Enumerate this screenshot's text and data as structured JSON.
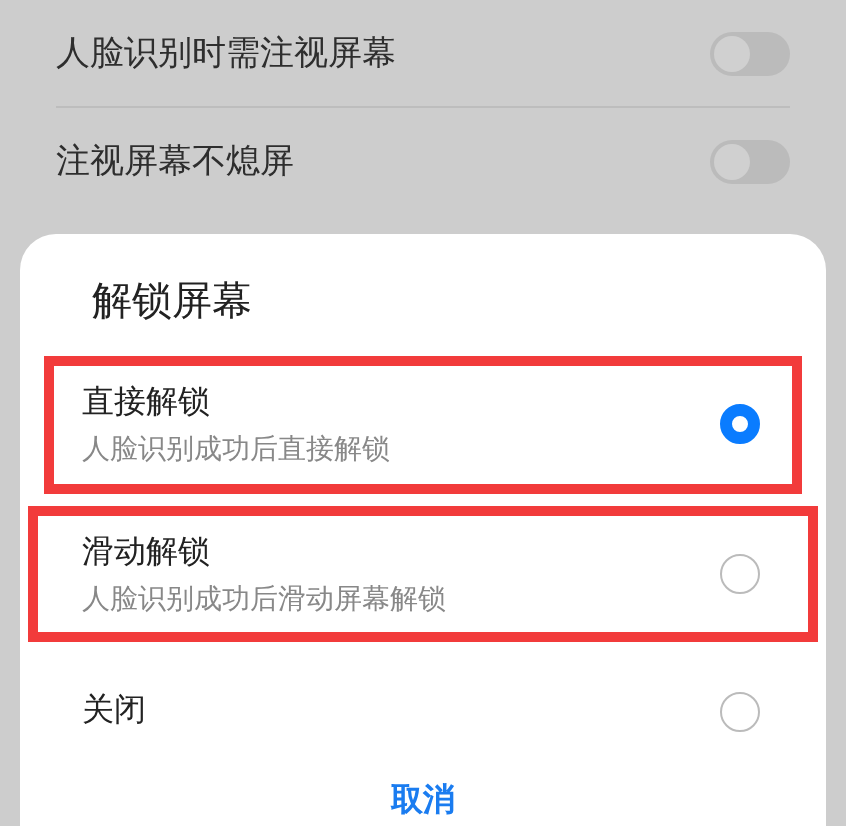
{
  "settings": [
    {
      "label": "人脸识别时需注视屏幕",
      "on": false
    },
    {
      "label": "注视屏幕不熄屏",
      "on": false
    }
  ],
  "dialog": {
    "title": "解锁屏幕",
    "options": [
      {
        "label": "直接解锁",
        "description": "人脸识别成功后直接解锁",
        "selected": true,
        "highlighted": true
      },
      {
        "label": "滑动解锁",
        "description": "人脸识别成功后滑动屏幕解锁",
        "selected": false,
        "highlighted": true
      },
      {
        "label": "关闭",
        "selected": false,
        "highlighted": false
      }
    ],
    "cancel": "取消"
  }
}
